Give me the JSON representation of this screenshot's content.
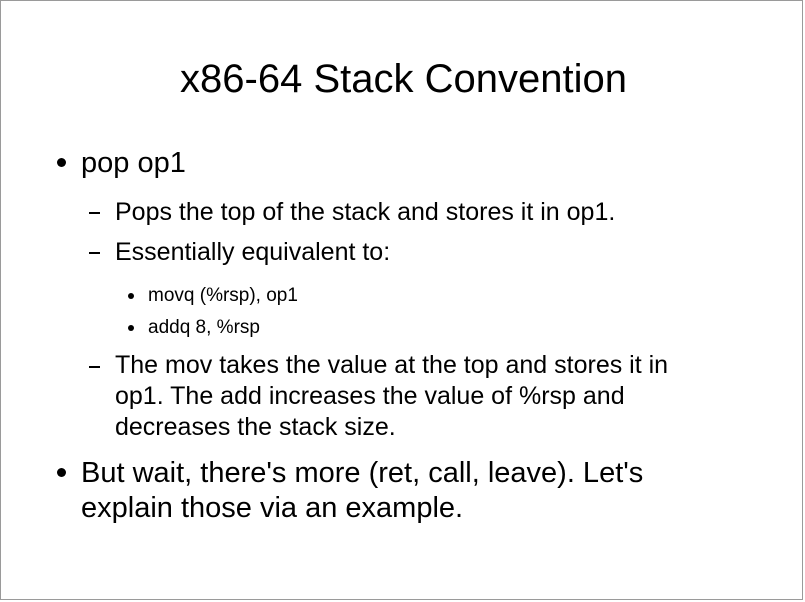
{
  "slide": {
    "title": "x86-64 Stack Convention",
    "bullets": [
      {
        "text": "pop op1",
        "subitems": [
          {
            "text": "Pops the top of the stack and stores it in op1."
          },
          {
            "text": "Essentially equivalent to:",
            "subitems": [
              {
                "text": "movq (%rsp), op1"
              },
              {
                "text": "addq 8, %rsp"
              }
            ]
          },
          {
            "lines": [
              "The mov takes the value at the top and stores it in",
              "op1. The add increases the value of %rsp and",
              "decreases the stack size."
            ]
          }
        ]
      },
      {
        "lines": [
          "But wait, there's more (ret, call, leave). Let's",
          "explain those via an example."
        ]
      }
    ]
  }
}
